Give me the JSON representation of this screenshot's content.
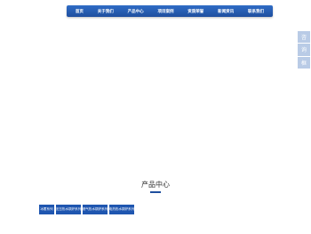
{
  "nav": {
    "items": [
      {
        "label": "首页"
      },
      {
        "label": "关于我们"
      },
      {
        "label": "产品中心"
      },
      {
        "label": "项目案例"
      },
      {
        "label": "资质荣誉"
      },
      {
        "label": "新闻资讯"
      },
      {
        "label": "联系我们"
      }
    ]
  },
  "side_float": {
    "items": [
      {
        "label": "咨"
      },
      {
        "label": "询"
      },
      {
        "label": "框"
      }
    ]
  },
  "products": {
    "title": "产品中心",
    "tabs": [
      {
        "label": "冰蓄系列"
      },
      {
        "label": "无压热水锅炉系列"
      },
      {
        "label": "燃气热水锅炉系列"
      },
      {
        "label": "电热热水锅炉系列"
      }
    ]
  },
  "colors": {
    "nav_bg": "#1f4f9e",
    "tab_bg": "#1f56b0",
    "side_bg": "#b9cbe6",
    "underline": "#1f4f9e"
  }
}
